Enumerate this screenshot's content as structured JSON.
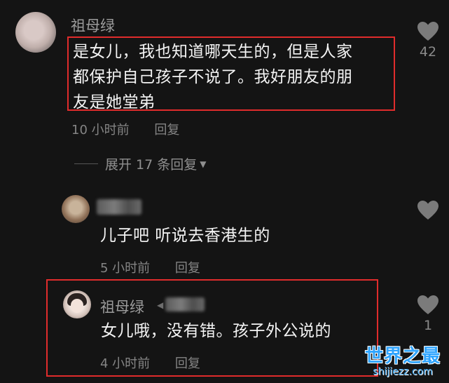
{
  "comments": [
    {
      "username": "祖母绿",
      "lines": [
        "是女儿，我也知道哪天生的，但是人家",
        "都保护自己孩子不说了。我好朋友的朋",
        "友是她堂弟"
      ],
      "time": "10 小时前",
      "reply_label": "回复",
      "likes": "42"
    },
    {
      "username": "",
      "lines": [
        "儿子吧 听说去香港生的"
      ],
      "time": "5 小时前",
      "reply_label": "回复",
      "likes": ""
    },
    {
      "username": "祖母绿",
      "lines": [
        "女儿哦，没有错。孩子外公说的"
      ],
      "time": "4 小时前",
      "reply_label": "回复",
      "likes": "1"
    }
  ],
  "expand_replies": "展开 17 条回复",
  "watermark": {
    "title": "世界之最",
    "url": "shijiezz.com"
  }
}
